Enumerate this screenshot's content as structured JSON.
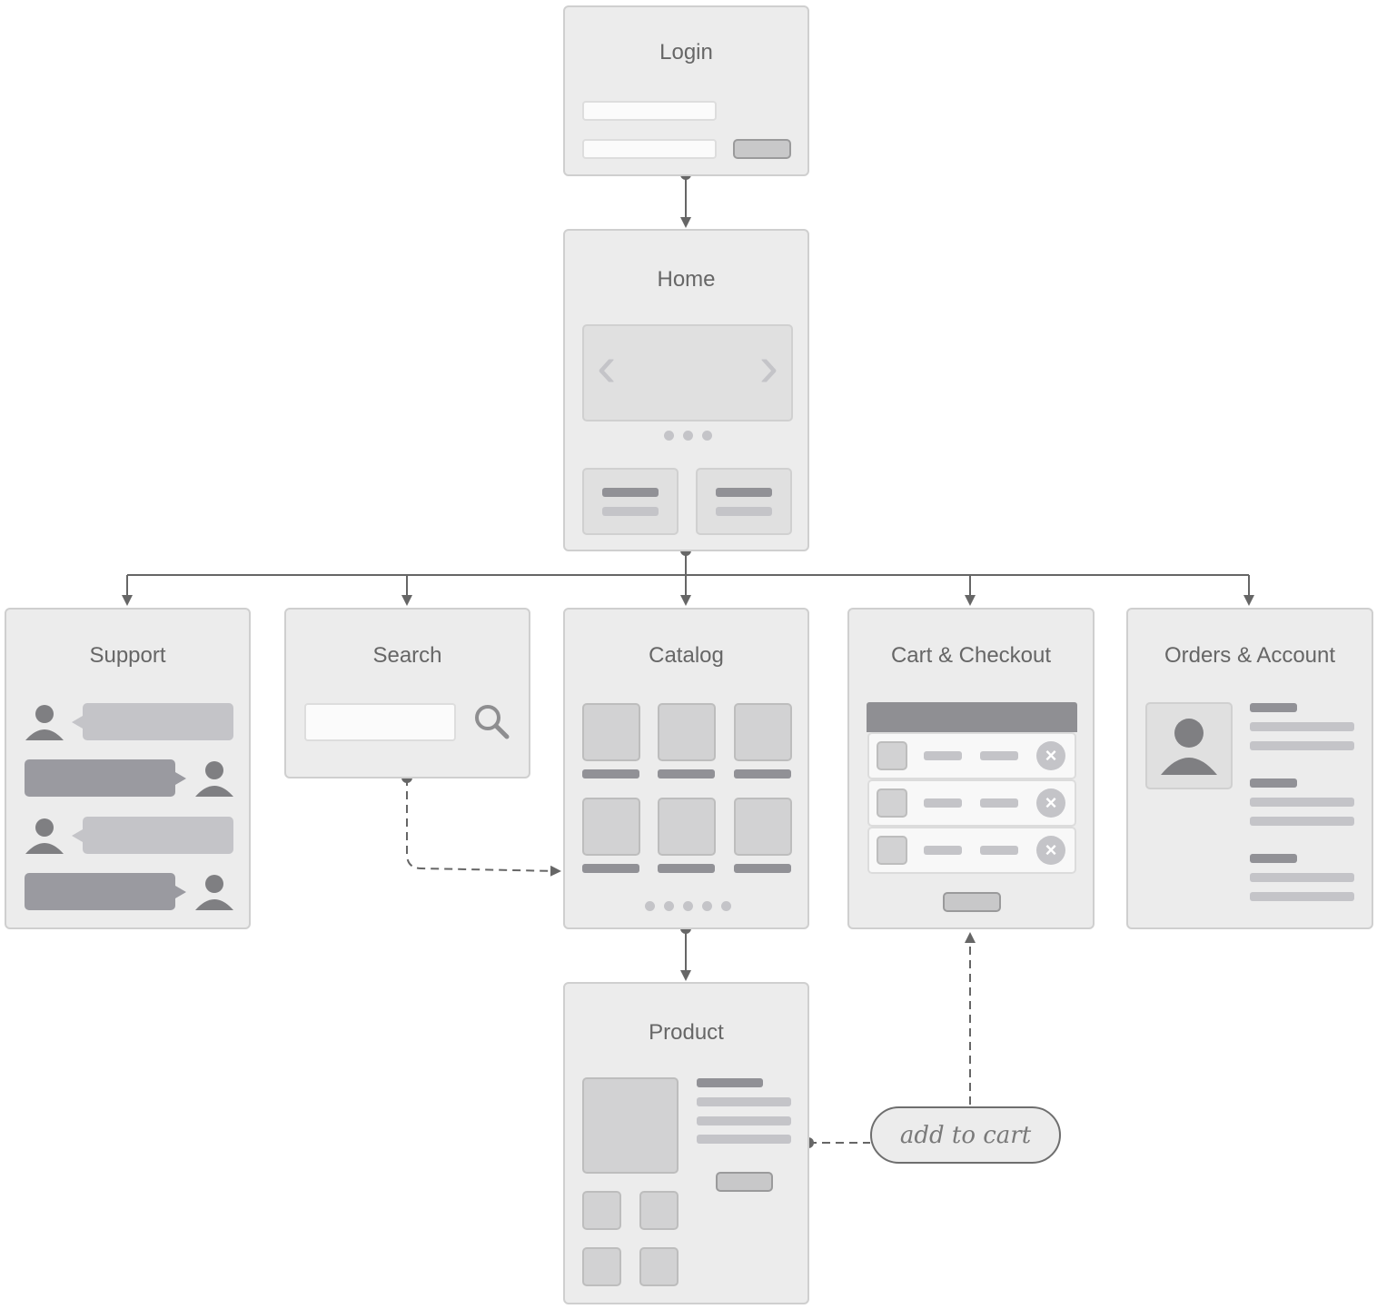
{
  "screens": {
    "login": {
      "title": "Login",
      "fields": [
        "username-field",
        "password-field"
      ],
      "action": "login-button"
    },
    "home": {
      "title": "Home",
      "carousel": {
        "prev_icon": "‹",
        "next_icon": "›",
        "page_dots": 3
      },
      "tiles": 2
    },
    "support": {
      "title": "Support",
      "messages": [
        {
          "from": "agent",
          "side": "left"
        },
        {
          "from": "user",
          "side": "right"
        },
        {
          "from": "agent",
          "side": "left"
        },
        {
          "from": "user",
          "side": "right"
        }
      ]
    },
    "search": {
      "title": "Search",
      "icon": "search-icon"
    },
    "catalog": {
      "title": "Catalog",
      "grid_items": 6,
      "page_dots": 5
    },
    "cart": {
      "title": "Cart & Checkout",
      "rows": 3,
      "remove_icon": "×"
    },
    "orders": {
      "title": "Orders & Account",
      "sections": 3
    },
    "product": {
      "title": "Product",
      "gallery_thumbs": 4
    }
  },
  "action_label": "add to cart",
  "flows": [
    {
      "from": "Login",
      "to": "Home",
      "style": "solid"
    },
    {
      "from": "Home",
      "to": "Support",
      "style": "solid"
    },
    {
      "from": "Home",
      "to": "Search",
      "style": "solid"
    },
    {
      "from": "Home",
      "to": "Catalog",
      "style": "solid"
    },
    {
      "from": "Home",
      "to": "Cart & Checkout",
      "style": "solid"
    },
    {
      "from": "Home",
      "to": "Orders & Account",
      "style": "solid"
    },
    {
      "from": "Search",
      "to": "Catalog",
      "style": "dashed"
    },
    {
      "from": "Catalog",
      "to": "Product",
      "style": "solid"
    },
    {
      "from": "Product",
      "to": "Cart & Checkout",
      "style": "dashed",
      "label": "add to cart"
    }
  ],
  "colors": {
    "card_bg": "#ececec",
    "card_border": "#cfcfcf",
    "connector": "#666666",
    "text": "#666666"
  }
}
